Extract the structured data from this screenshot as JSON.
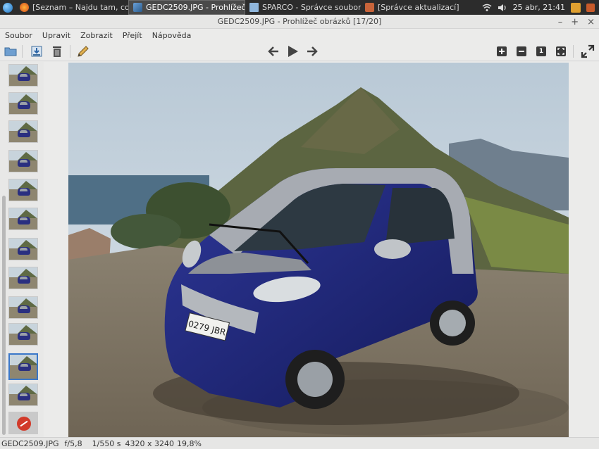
{
  "taskbar": {
    "tasks": [
      {
        "label": "[Seznam – Najdu tam, co ...",
        "icon": "firefox-icon",
        "active": false
      },
      {
        "label": "GEDC2509.JPG - Prohlížeč ...",
        "icon": "image-viewer-icon",
        "active": true
      },
      {
        "label": "SPARCO - Správce souborů",
        "icon": "folder-icon",
        "active": false
      },
      {
        "label": "[Správce aktualizací]",
        "icon": "update-manager-icon",
        "active": false
      }
    ],
    "clock": "25 abr, 21:41"
  },
  "window": {
    "title": "GEDC2509.JPG - Prohlížeč obrázků [17/20]",
    "minimize": "–",
    "maximize": "+",
    "close": "×"
  },
  "menu": {
    "file": "Soubor",
    "edit": "Upravit",
    "view": "Zobrazit",
    "go": "Přejít",
    "help": "Nápověda"
  },
  "toolbar_icons": {
    "open": "folder-open-icon",
    "save": "save-icon",
    "delete": "trash-icon",
    "edit": "pencil-icon",
    "prev": "arrow-left-icon",
    "play": "play-icon",
    "next": "arrow-right-icon",
    "zoom_in": "zoom-in-icon",
    "zoom_out": "zoom-out-icon",
    "zoom_100": "zoom-100-icon",
    "zoom_fit": "zoom-fit-icon",
    "fullscreen": "fullscreen-icon"
  },
  "toolbar_labels": {
    "zoom_100": "1"
  },
  "thumbnails": {
    "count_label": "20",
    "selected_index": 10,
    "error_index": 12
  },
  "status": {
    "filename": "GEDC2509.JPG",
    "aperture": "f/5,8",
    "exposure": "1/550 s",
    "dimensions": "4320 x 3240",
    "zoom": "19,8%"
  },
  "colors": {
    "accent": "#3b78c9",
    "taskbar": "#2c2c2c"
  }
}
